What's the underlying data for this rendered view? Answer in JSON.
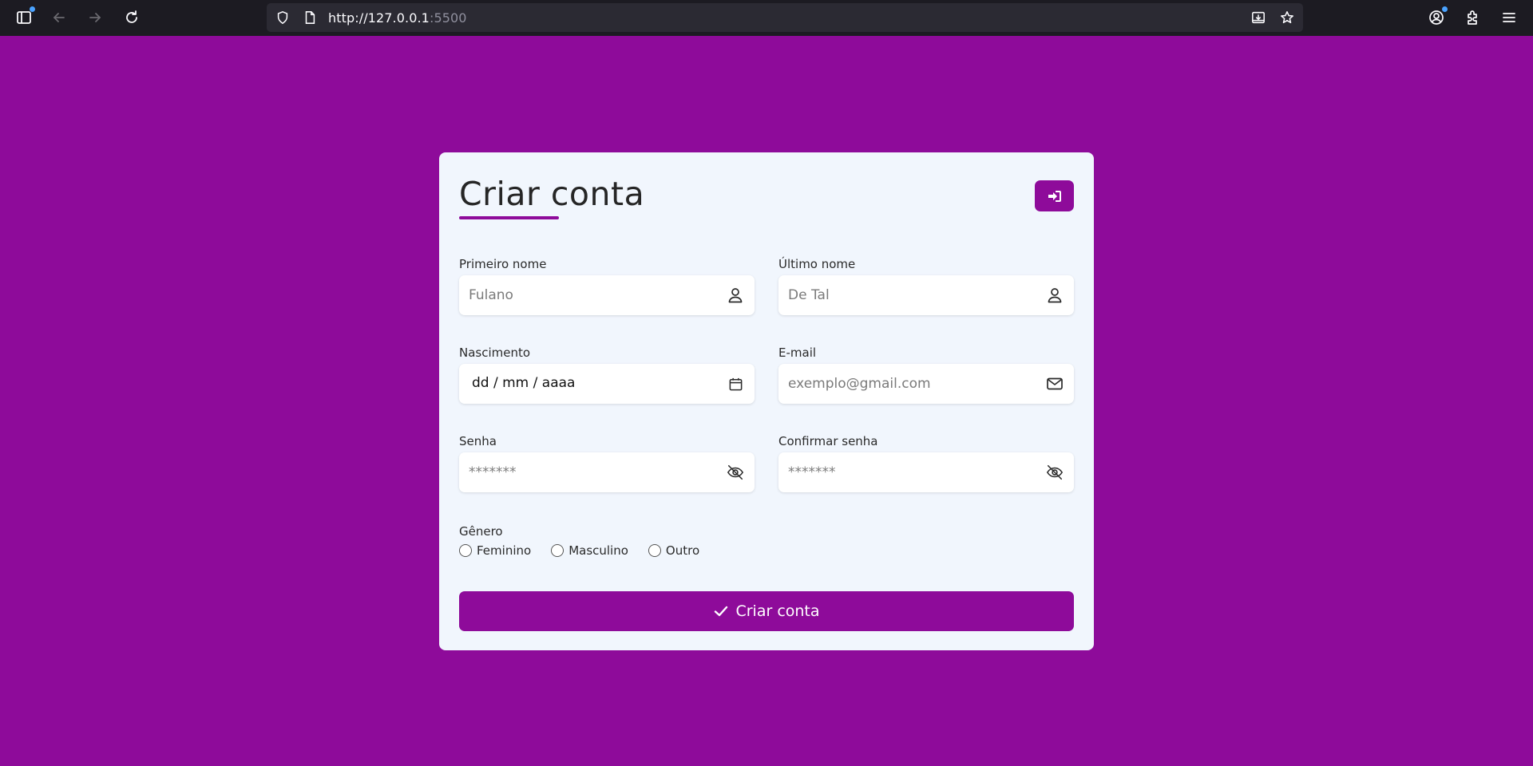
{
  "browser": {
    "url_host": "http://127.0.0.1",
    "url_port": ":5500"
  },
  "form": {
    "title": "Criar conta",
    "first_name": {
      "label": "Primeiro nome",
      "placeholder": "Fulano",
      "icon": "user-icon"
    },
    "last_name": {
      "label": "Último nome",
      "placeholder": "De Tal",
      "icon": "user-icon"
    },
    "birth": {
      "label": "Nascimento",
      "value": "dd / mm / aaaa",
      "icon": "calendar-icon"
    },
    "email": {
      "label": "E-mail",
      "placeholder": "exemplo@gmail.com",
      "icon": "envelope-icon"
    },
    "password": {
      "label": "Senha",
      "placeholder": "*******",
      "icon": "eye-slash-icon"
    },
    "confirm_password": {
      "label": "Confirmar senha",
      "placeholder": "*******",
      "icon": "eye-slash-icon"
    },
    "gender": {
      "label": "Gênero",
      "options": [
        "Feminino",
        "Masculino",
        "Outro"
      ]
    },
    "submit_label": "Criar conta"
  },
  "colors": {
    "brand": "#8e0b9a",
    "card": "#f1f6fd",
    "browser_bar": "#1c1b22"
  }
}
